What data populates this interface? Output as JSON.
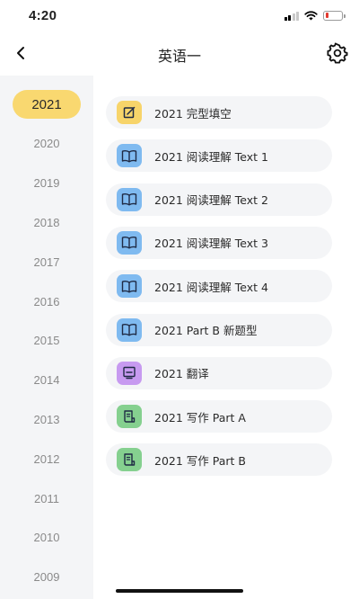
{
  "status_bar": {
    "time": "4:20"
  },
  "nav": {
    "title": "英语一",
    "back_icon": "chevron-left-icon",
    "settings_icon": "gear-icon"
  },
  "sidebar": {
    "selected": "2021",
    "years": [
      "2021",
      "2020",
      "2019",
      "2018",
      "2017",
      "2016",
      "2015",
      "2014",
      "2013",
      "2012",
      "2011",
      "2010",
      "2009"
    ]
  },
  "sections": [
    {
      "label": "2021 完型填空",
      "icon": "edit-icon",
      "color": "#f7d46a"
    },
    {
      "label": "2021 阅读理解 Text 1",
      "icon": "book-icon",
      "color": "#7fbaf0"
    },
    {
      "label": "2021 阅读理解 Text 2",
      "icon": "book-icon",
      "color": "#7fbaf0"
    },
    {
      "label": "2021 阅读理解 Text 3",
      "icon": "book-icon",
      "color": "#7fbaf0"
    },
    {
      "label": "2021 阅读理解 Text 4",
      "icon": "book-icon",
      "color": "#7fbaf0"
    },
    {
      "label": "2021 Part B 新题型",
      "icon": "book-icon",
      "color": "#7fbaf0"
    },
    {
      "label": "2021 翻译",
      "icon": "translate-icon",
      "color": "#c79af0"
    },
    {
      "label": "2021 写作 Part A",
      "icon": "document-icon",
      "color": "#85d08f"
    },
    {
      "label": "2021 写作 Part B",
      "icon": "document-icon",
      "color": "#85d08f"
    }
  ]
}
